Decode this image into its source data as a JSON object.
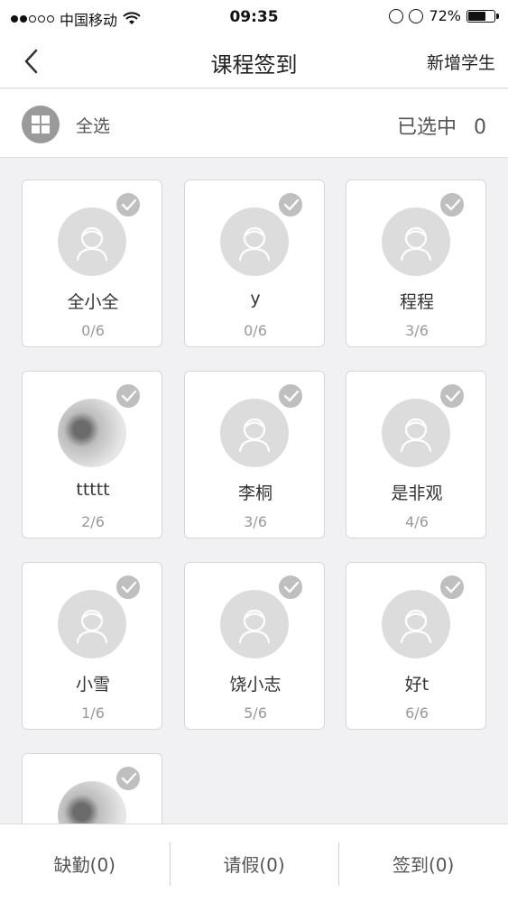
{
  "status_bar": {
    "carrier": "中国移动",
    "time": "09:35",
    "battery_text": "72%",
    "battery_level": 0.72
  },
  "nav": {
    "title": "课程签到",
    "action_label": "新增学生"
  },
  "select_bar": {
    "select_all_label": "全选",
    "selected_label": "已选中",
    "selected_count": "0"
  },
  "students": [
    {
      "name": "全小全",
      "progress": "0/6",
      "avatar": "default-avatar-icon"
    },
    {
      "name": "y",
      "progress": "0/6",
      "avatar": "default-avatar-icon"
    },
    {
      "name": "程程",
      "progress": "3/6",
      "avatar": "default-avatar-icon"
    },
    {
      "name": "ttttt",
      "progress": "2/6",
      "avatar": "photo"
    },
    {
      "name": "李桐",
      "progress": "3/6",
      "avatar": "default-avatar-icon"
    },
    {
      "name": "是非观",
      "progress": "4/6",
      "avatar": "default-avatar-icon"
    },
    {
      "name": "小雪",
      "progress": "1/6",
      "avatar": "default-avatar-icon"
    },
    {
      "name": "饶小志",
      "progress": "5/6",
      "avatar": "default-avatar-icon"
    },
    {
      "name": "好t",
      "progress": "6/6",
      "avatar": "default-avatar-icon"
    },
    {
      "name": "",
      "progress": "",
      "avatar": "photo"
    }
  ],
  "bottom_bar": {
    "absent_label": "缺勤(0)",
    "leave_label": "请假(0)",
    "sign_in_label": "签到(0)"
  },
  "colors": {
    "badge_gray": "#bfbfbf",
    "avatar_bg": "#dcdcdc",
    "background": "#f1f1f3"
  }
}
